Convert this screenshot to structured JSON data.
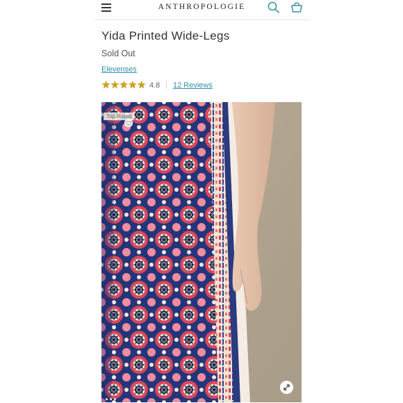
{
  "header": {
    "logo": "ANTHROPOLOGIE",
    "menu_icon": "hamburger-menu-icon",
    "search_icon": "search-icon",
    "bag_icon": "shopping-bag-icon"
  },
  "product": {
    "title": "Yida Printed Wide-Legs",
    "status": "Sold Out",
    "brand": "Elevenses",
    "rating": "4.8",
    "stars": 4.8,
    "reviews_label": "12 Reviews"
  },
  "image": {
    "badge": "Top Rated",
    "expand_icon": "expand-arrows-icon",
    "favorite_icon": "heart-icon",
    "carousel_dots": 3
  },
  "colors": {
    "link": "#2f8faa",
    "star": "#c9a227",
    "print_red": "#d8485a",
    "print_navy": "#263c86"
  }
}
